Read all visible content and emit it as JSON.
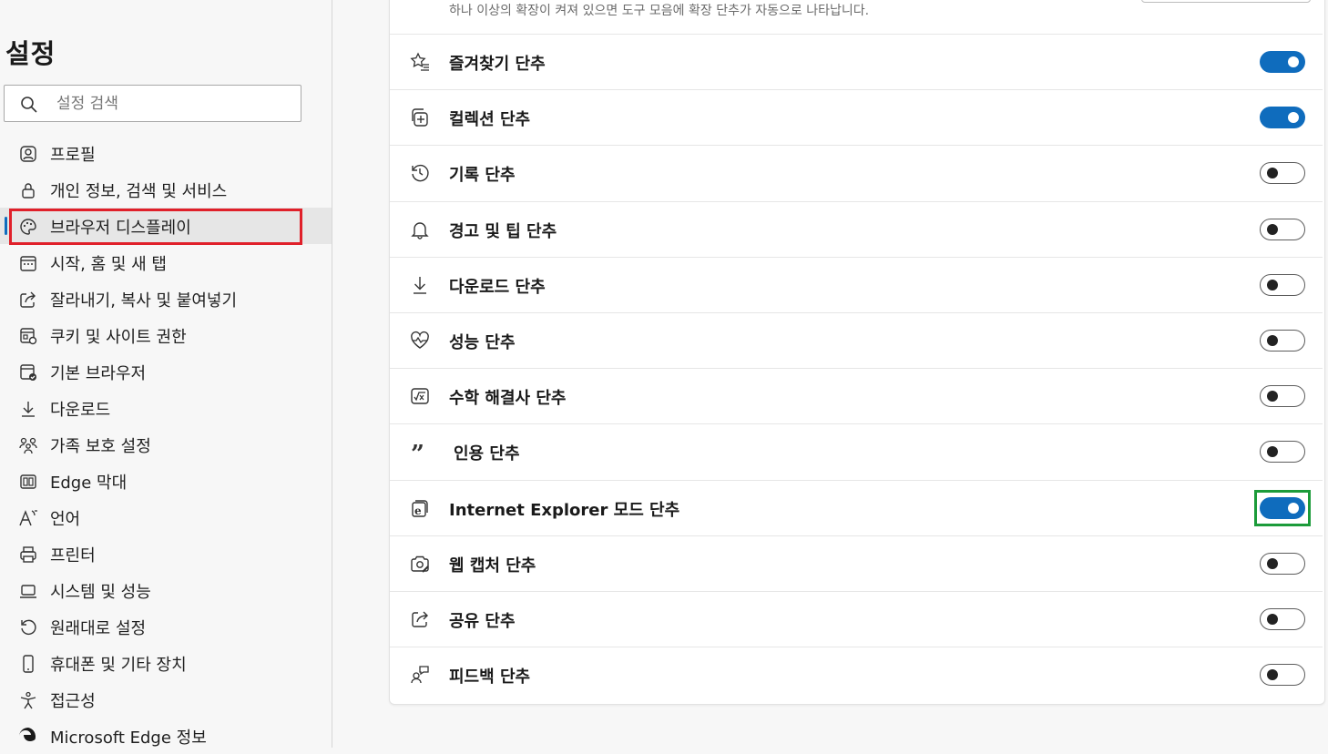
{
  "sidebar": {
    "title": "설정",
    "search_placeholder": "설정 검색",
    "items": [
      {
        "label": "프로필",
        "icon": "profile-icon"
      },
      {
        "label": "개인 정보, 검색 및 서비스",
        "icon": "lock-icon"
      },
      {
        "label": "브라우저 디스플레이",
        "icon": "palette-icon",
        "active": true
      },
      {
        "label": "시작, 홈 및 새 탭",
        "icon": "calendar-icon"
      },
      {
        "label": "잘라내기, 복사 및 붙여넣기",
        "icon": "share-arrow-icon"
      },
      {
        "label": "쿠키 및 사이트 권한",
        "icon": "site-permissions-icon"
      },
      {
        "label": "기본 브라우저",
        "icon": "default-browser-icon"
      },
      {
        "label": "다운로드",
        "icon": "download-icon"
      },
      {
        "label": "가족 보호 설정",
        "icon": "family-icon"
      },
      {
        "label": "Edge 막대",
        "icon": "edge-bar-icon"
      },
      {
        "label": "언어",
        "icon": "language-icon"
      },
      {
        "label": "프린터",
        "icon": "printer-icon"
      },
      {
        "label": "시스템 및 성능",
        "icon": "laptop-icon"
      },
      {
        "label": "원래대로 설정",
        "icon": "reset-icon"
      },
      {
        "label": "휴대폰 및 기타 장치",
        "icon": "phone-icon"
      },
      {
        "label": "접근성",
        "icon": "accessibility-icon"
      },
      {
        "label": "Microsoft Edge 정보",
        "icon": "edge-logo-icon"
      }
    ]
  },
  "main": {
    "top_description": "하나 이상의 확장이 켜져 있으면 도구 모음에 확장 단추가 자동으로 나타납니다.",
    "rows": [
      {
        "label": "즐겨찾기 단추",
        "icon": "favorites-icon",
        "enabled": true
      },
      {
        "label": "컬렉션 단추",
        "icon": "collections-icon",
        "enabled": true
      },
      {
        "label": "기록 단추",
        "icon": "history-icon",
        "enabled": false
      },
      {
        "label": "경고 및 팁 단추",
        "icon": "bell-icon",
        "enabled": false
      },
      {
        "label": "다운로드 단추",
        "icon": "download-icon",
        "enabled": false
      },
      {
        "label": "성능 단추",
        "icon": "heart-pulse-icon",
        "enabled": false
      },
      {
        "label": "수학 해결사 단추",
        "icon": "math-solver-icon",
        "enabled": false
      },
      {
        "label": "인용 단추",
        "icon": "quote-icon",
        "enabled": false
      },
      {
        "label": "Internet Explorer 모드 단추",
        "icon": "ie-mode-icon",
        "enabled": true
      },
      {
        "label": "웹 캡처 단추",
        "icon": "web-capture-icon",
        "enabled": false
      },
      {
        "label": "공유 단추",
        "icon": "share-icon",
        "enabled": false
      },
      {
        "label": "피드백 단추",
        "icon": "feedback-icon",
        "enabled": false
      }
    ]
  },
  "colors": {
    "accent": "#0f6cbd",
    "highlight_red": "#e0202a",
    "highlight_green": "#1c9b3a"
  }
}
